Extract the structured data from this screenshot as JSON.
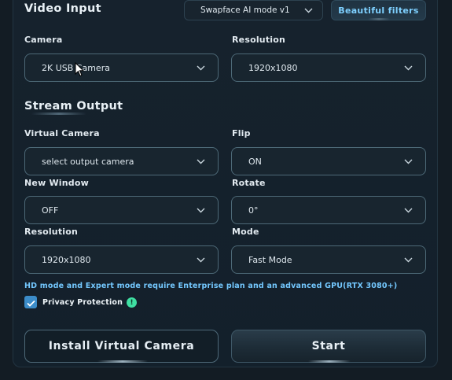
{
  "video_input": {
    "title": "Video Input",
    "mode_select": {
      "value": "Swapface AI mode v1"
    },
    "filters_button": "Beautiful filters",
    "camera": {
      "label": "Camera",
      "value": "2K USB Camera"
    },
    "resolution": {
      "label": "Resolution",
      "value": "1920x1080"
    }
  },
  "stream_output": {
    "title": "Stream Output",
    "virtual_camera": {
      "label": "Virtual Camera",
      "value": "select output camera"
    },
    "flip": {
      "label": "Flip",
      "value": "ON"
    },
    "new_window": {
      "label": "New Window",
      "value": "OFF"
    },
    "rotate": {
      "label": "Rotate",
      "value": "0°"
    },
    "resolution": {
      "label": "Resolution",
      "value": "1920x1080"
    },
    "mode": {
      "label": "Mode",
      "value": "Fast Mode"
    }
  },
  "note": "HD mode and Expert mode require Enterprise plan and an advanced GPU(RTX 3080+)",
  "privacy": {
    "label": "Privacy Protection",
    "checked": true,
    "info_icon": "!"
  },
  "actions": {
    "install_label": "Install Virtual Camera",
    "start_label": "Start"
  },
  "icons": {
    "chevron": "chevron-down-icon",
    "check": "check-icon",
    "info": "info-icon",
    "cursor": "mouse-cursor-icon"
  },
  "colors": {
    "accent_blue": "#74c8ff",
    "filters_text": "#7ed0ff",
    "checkbox": "#3b8cc9",
    "info_green": "#3fe0a3",
    "field_border": "#4d6977"
  }
}
